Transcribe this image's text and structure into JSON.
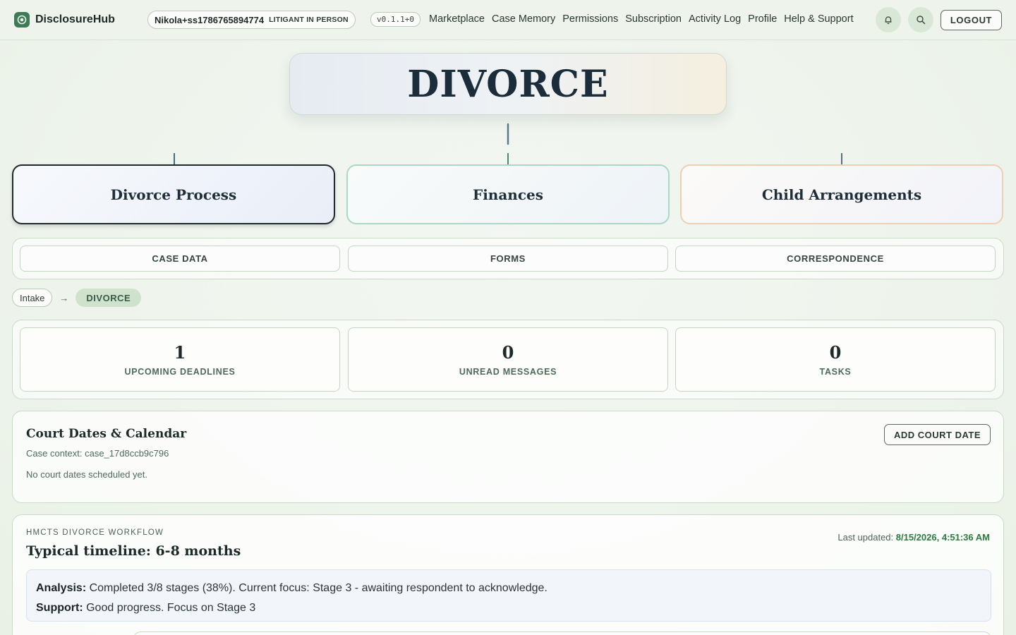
{
  "header": {
    "brand": "DisclosureHub",
    "user_name": "Nikola+ss1786765894774",
    "user_role": "LITIGANT IN PERSON",
    "version": "v0.1.1+0",
    "nav": [
      "Marketplace",
      "Case Memory",
      "Permissions",
      "Subscription",
      "Activity Log",
      "Profile",
      "Help & Support"
    ],
    "logout_label": "LOGOUT"
  },
  "mindmap": {
    "root": "DIVORCE",
    "branches": [
      "Divorce Process",
      "Finances",
      "Child Arrangements"
    ]
  },
  "tabs": [
    "CASE DATA",
    "FORMS",
    "CORRESPONDENCE"
  ],
  "breadcrumb": {
    "parent": "Intake",
    "current": "DIVORCE"
  },
  "stats": [
    {
      "value": "1",
      "label": "UPCOMING DEADLINES"
    },
    {
      "value": "0",
      "label": "UNREAD MESSAGES"
    },
    {
      "value": "0",
      "label": "TASKS"
    }
  ],
  "court": {
    "title": "Court Dates & Calendar",
    "context": "Case context: case_17d8ccb9c796",
    "empty": "No court dates scheduled yet.",
    "add_label": "ADD COURT DATE"
  },
  "workflow": {
    "kicker": "HMCTS DIVORCE WORKFLOW",
    "title": "Typical timeline: 6-8 months",
    "updated_label": "Last updated:",
    "updated_value": "8/15/2026, 4:51:36 AM",
    "analysis_label": "Analysis:",
    "analysis_text": "Completed 3/8 stages (38%). Current focus: Stage 3 - awaiting respondent to acknowledge.",
    "support_label": "Support:",
    "support_text": "Good progress. Focus on Stage 3"
  },
  "colors": {
    "accent": "#3e7a56",
    "updated": "#2c7a3f"
  }
}
